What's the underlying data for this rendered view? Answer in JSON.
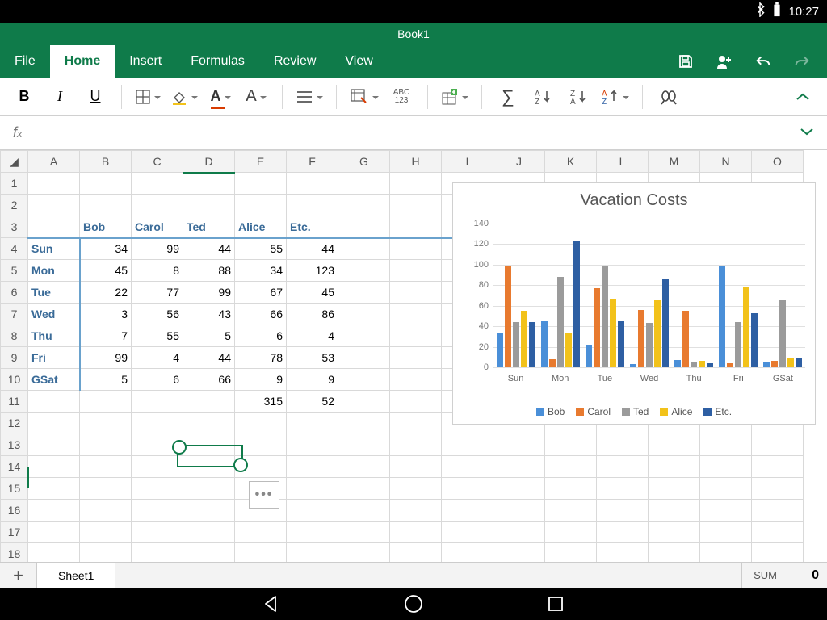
{
  "status": {
    "time": "10:27"
  },
  "title": "Book1",
  "tabs": [
    "File",
    "Home",
    "Insert",
    "Formulas",
    "Review",
    "View"
  ],
  "active_tab": "Home",
  "columns": [
    "A",
    "B",
    "C",
    "D",
    "E",
    "F",
    "G",
    "H",
    "I",
    "J",
    "K",
    "L",
    "M",
    "N",
    "O"
  ],
  "selected_col": "D",
  "row_count": 20,
  "headers_row": 3,
  "people": [
    "Bob",
    "Carol",
    "Ted",
    "Alice",
    "Etc."
  ],
  "days": [
    "Sun",
    "Mon",
    "Tue",
    "Wed",
    "Thu",
    "Fri",
    "GSat"
  ],
  "table": [
    [
      34,
      99,
      44,
      55,
      44
    ],
    [
      45,
      8,
      88,
      34,
      123
    ],
    [
      22,
      77,
      99,
      67,
      45
    ],
    [
      3,
      56,
      43,
      66,
      86
    ],
    [
      7,
      55,
      5,
      6,
      4
    ],
    [
      99,
      4,
      44,
      78,
      53
    ],
    [
      5,
      6,
      66,
      9,
      9
    ]
  ],
  "totals_row": {
    "E": 315,
    "F": 52
  },
  "sheet": {
    "name": "Sheet1",
    "sum_label": "SUM",
    "sum_value": "0"
  },
  "chart_data": {
    "type": "bar",
    "title": "Vacation Costs",
    "categories": [
      "Sun",
      "Mon",
      "Tue",
      "Wed",
      "Thu",
      "Fri",
      "GSat"
    ],
    "series": [
      {
        "name": "Bob",
        "values": [
          34,
          45,
          22,
          3,
          7,
          99,
          5
        ]
      },
      {
        "name": "Carol",
        "values": [
          99,
          8,
          77,
          56,
          55,
          4,
          6
        ]
      },
      {
        "name": "Ted",
        "values": [
          44,
          88,
          99,
          43,
          5,
          44,
          66
        ]
      },
      {
        "name": "Alice",
        "values": [
          55,
          34,
          67,
          66,
          6,
          78,
          9
        ]
      },
      {
        "name": "Etc.",
        "values": [
          44,
          123,
          45,
          86,
          4,
          53,
          9
        ]
      }
    ],
    "ylim": [
      0,
      140
    ],
    "yticks": [
      0,
      20,
      40,
      60,
      80,
      100,
      120,
      140
    ],
    "colors": [
      "#4a8fd8",
      "#e87a2f",
      "#9b9b9b",
      "#f2c21a",
      "#2e5fa3"
    ]
  }
}
